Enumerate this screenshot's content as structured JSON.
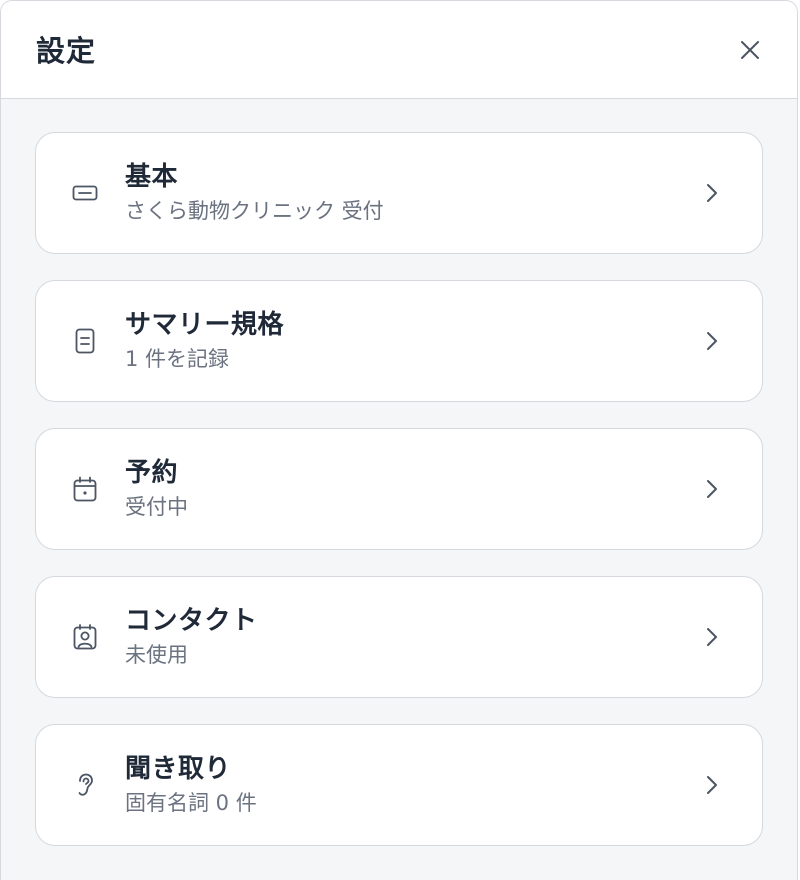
{
  "header": {
    "title": "設定",
    "close_icon": "close-icon"
  },
  "items": [
    {
      "title": "基本",
      "subtitle": "さくら動物クリニック 受付",
      "icon": "id-card-icon"
    },
    {
      "title": "サマリー規格",
      "subtitle": "1 件を記録",
      "icon": "document-icon"
    },
    {
      "title": "予約",
      "subtitle": "受付中",
      "icon": "calendar-icon"
    },
    {
      "title": "コンタクト",
      "subtitle": "未使用",
      "icon": "contact-icon"
    },
    {
      "title": "聞き取り",
      "subtitle": "固有名詞 0 件",
      "icon": "ear-icon"
    }
  ],
  "colors": {
    "background": "#f4f6f8",
    "card": "#ffffff",
    "border": "#d5d9de",
    "title_text": "#1f2937",
    "subtitle_text": "#6b7280",
    "icon": "#4b5563"
  }
}
